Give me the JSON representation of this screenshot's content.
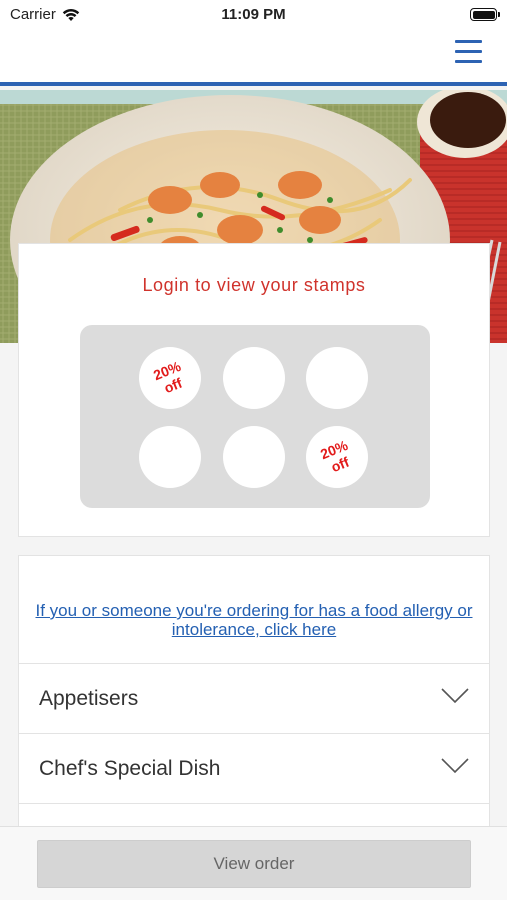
{
  "status_bar": {
    "carrier": "Carrier",
    "time": "11:09 PM",
    "wifi_icon": "wifi-icon",
    "battery_icon": "battery-icon"
  },
  "nav": {
    "menu_icon": "hamburger-menu-icon",
    "accent_color": "#2d63b3"
  },
  "hero": {
    "description_icon": "food-photo"
  },
  "stamps": {
    "title": "Login to view your stamps",
    "title_color": "#d0332c",
    "slots": [
      {
        "label": "20%\noff",
        "rewarded": true
      },
      {
        "label": "",
        "rewarded": false
      },
      {
        "label": "",
        "rewarded": false
      },
      {
        "label": "",
        "rewarded": false
      },
      {
        "label": "",
        "rewarded": false
      },
      {
        "label": "20%\noff",
        "rewarded": true
      }
    ]
  },
  "menu": {
    "allergy_link": "If you or someone you're ordering for has a food allergy or intolerance, click here",
    "link_color": "#2460b2",
    "categories": [
      {
        "label": "Appetisers",
        "icon": "chevron-down-icon"
      },
      {
        "label": "Chef's Special Dish",
        "icon": "chevron-down-icon"
      }
    ]
  },
  "bottom": {
    "view_order_label": "View order"
  }
}
